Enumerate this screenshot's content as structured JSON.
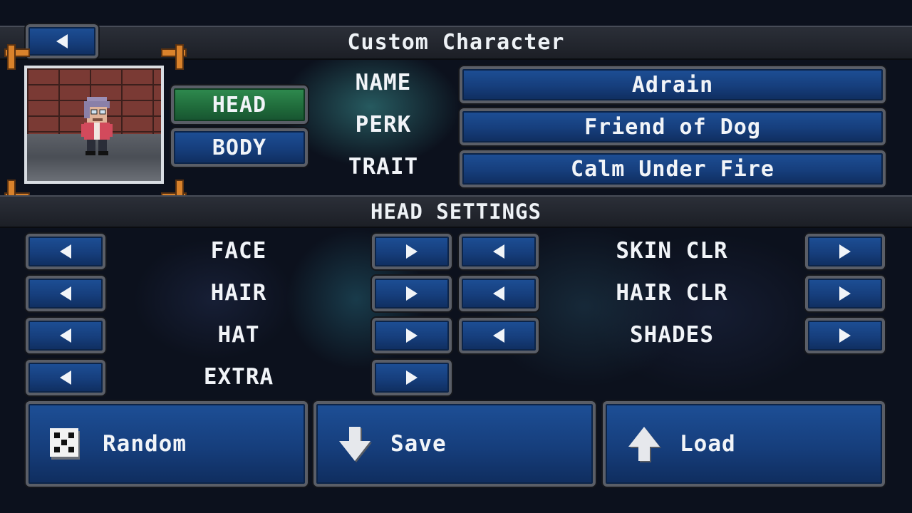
{
  "header": {
    "title": "Custom Character"
  },
  "character": {
    "tabs": [
      {
        "label": "HEAD",
        "active": true
      },
      {
        "label": "BODY",
        "active": false
      }
    ],
    "fields": [
      {
        "label": "NAME",
        "value": "Adrain"
      },
      {
        "label": "PERK",
        "value": "Friend of Dog"
      },
      {
        "label": "TRAIT",
        "value": "Calm Under Fire"
      }
    ]
  },
  "section": {
    "title": "HEAD SETTINGS"
  },
  "settings_left": [
    "FACE",
    "HAIR",
    "HAT",
    "EXTRA"
  ],
  "settings_right": [
    "SKIN CLR",
    "HAIR CLR",
    "SHADES"
  ],
  "actions": {
    "random": "Random",
    "save": "Save",
    "load": "Load"
  },
  "colors": {
    "button_blue": "#1d4f96",
    "active_green": "#2f8b4f",
    "frame_orange": "#d9822b"
  }
}
